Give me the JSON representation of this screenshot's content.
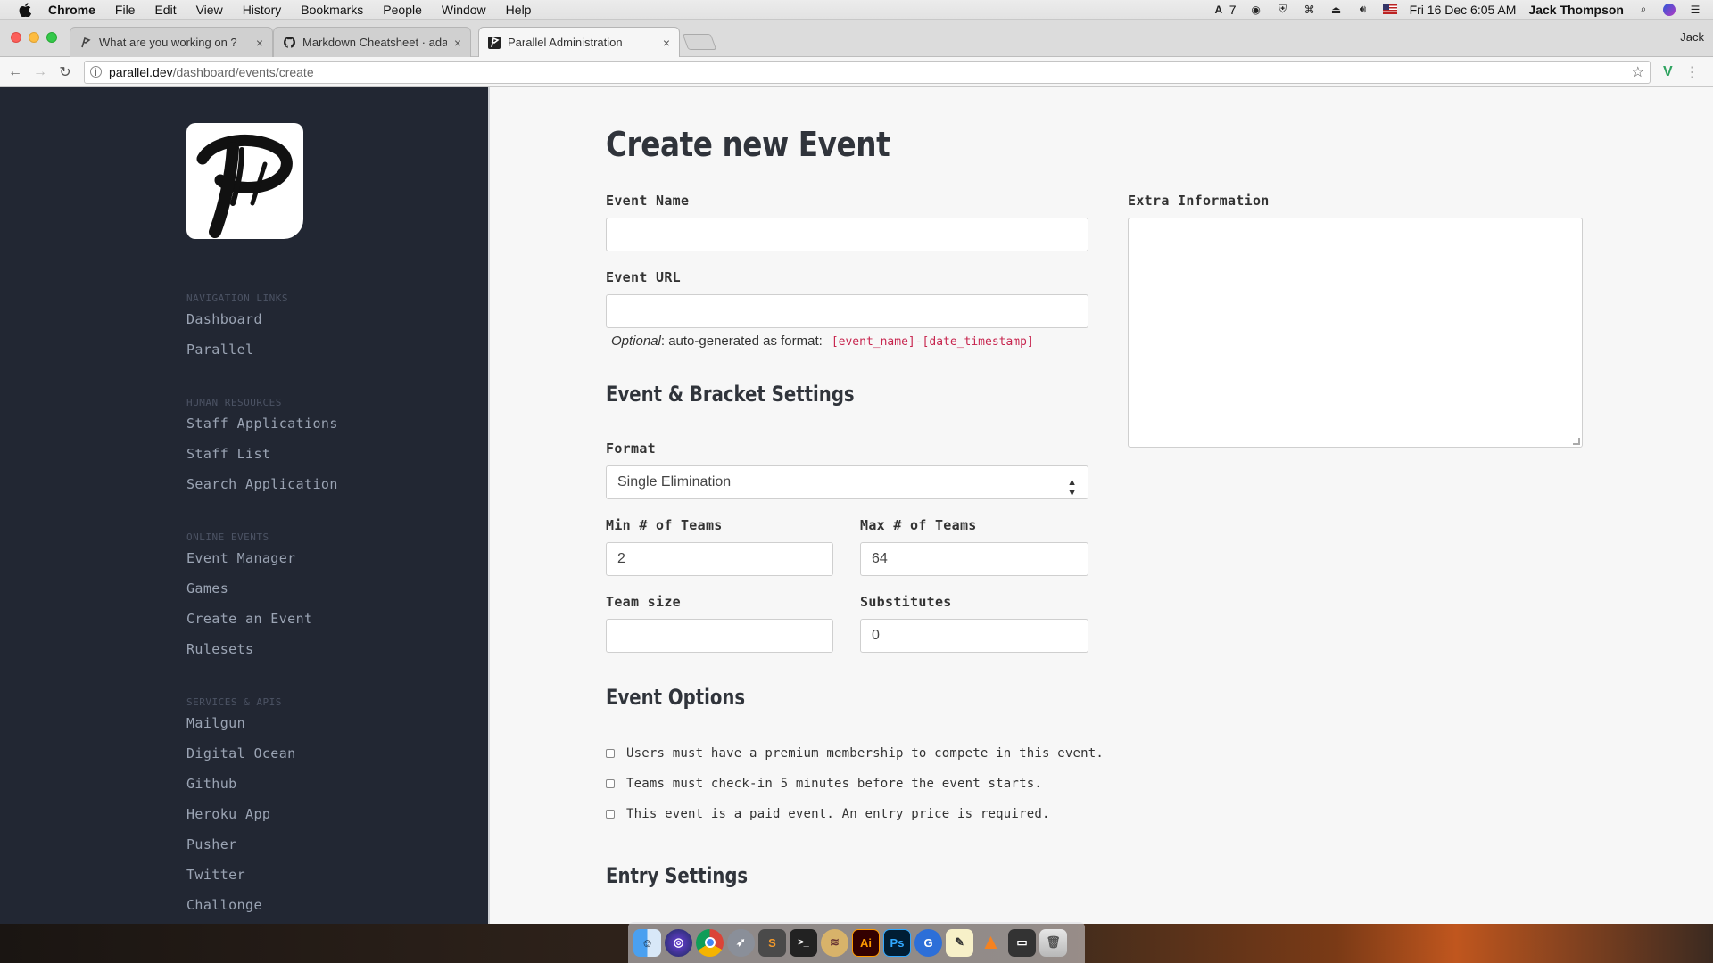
{
  "menubar": {
    "app_name": "Chrome",
    "items": [
      "File",
      "Edit",
      "View",
      "History",
      "Bookmarks",
      "People",
      "Window",
      "Help"
    ],
    "tray_text": "7",
    "clock": "Fri 16 Dec  6:05 AM",
    "user": "Jack Thompson"
  },
  "browser": {
    "tabs": [
      {
        "title": "What are you working on ?",
        "icon": "parallel-icon"
      },
      {
        "title": "Markdown Cheatsheet · adam-p",
        "icon": "github-icon"
      },
      {
        "title": "Parallel Administration",
        "icon": "parallel-icon"
      }
    ],
    "active_tab": 2,
    "profile_name": "Jack",
    "url_host": "parallel.dev",
    "url_path": "/dashboard/events/create"
  },
  "sidebar": {
    "sections": [
      {
        "heading": "Navigation Links",
        "links": [
          "Dashboard",
          "Parallel"
        ]
      },
      {
        "heading": "Human Resources",
        "links": [
          "Staff Applications",
          "Staff List",
          "Search Application"
        ]
      },
      {
        "heading": "Online Events",
        "links": [
          "Event Manager",
          "Games",
          "Create an Event",
          "Rulesets"
        ]
      },
      {
        "heading": "Services & APIs",
        "links": [
          "Mailgun",
          "Digital Ocean",
          "Github",
          "Heroku App",
          "Pusher",
          "Twitter",
          "Challonge"
        ]
      }
    ]
  },
  "form": {
    "page_title": "Create new Event",
    "event_name_label": "Event Name",
    "event_name_value": "",
    "event_url_label": "Event URL",
    "event_url_value": "",
    "url_help_optional": "Optional",
    "url_help_text": ": auto-generated as format:",
    "url_help_code": "[event_name]-[date_timestamp]",
    "extra_info_label": "Extra Information",
    "bracket_heading": "Event & Bracket Settings",
    "format_label": "Format",
    "format_value": "Single Elimination",
    "min_teams_label": "Min # of Teams",
    "min_teams_value": "2",
    "max_teams_label": "Max # of Teams",
    "max_teams_value": "64",
    "team_size_label": "Team size",
    "team_size_value": "",
    "subs_label": "Substitutes",
    "subs_value": "0",
    "options_heading": "Event Options",
    "options": [
      "Users must have a premium membership to compete in this event.",
      "Teams must check-in 5 minutes before the event starts.",
      "This event is a paid event. An entry price is required."
    ],
    "entry_heading": "Entry Settings"
  },
  "dock": [
    "finder-icon",
    "siri-icon",
    "chrome-icon",
    "launchpad-icon",
    "sublime-icon",
    "terminal-icon",
    "sequel-icon",
    "illustrator-icon",
    "photoshop-icon",
    "git-icon",
    "notes-icon",
    "vlc-icon",
    "screen-icon",
    "trash-icon"
  ],
  "colors": {
    "sidebar_bg": "#222733",
    "page_bg": "#f7f7f7",
    "code_red": "#c7254e"
  }
}
